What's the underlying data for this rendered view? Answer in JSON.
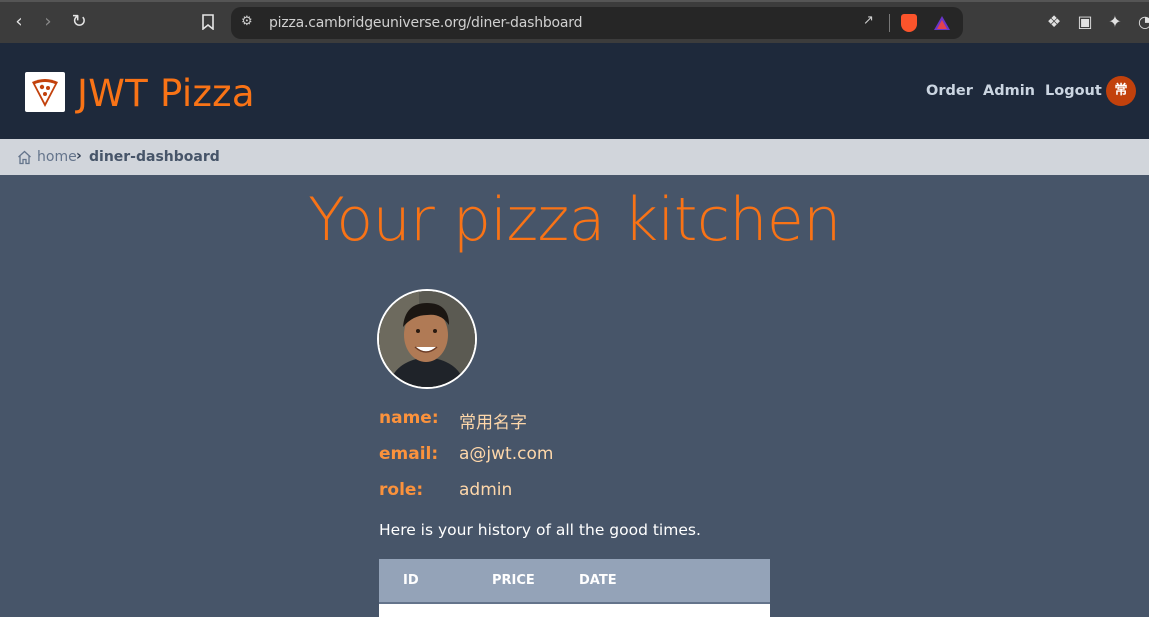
{
  "browser": {
    "url": "pizza.cambridgeuniverse.org/diner-dashboard"
  },
  "header": {
    "app_title": "JWT Pizza",
    "nav": [
      {
        "label": "Order"
      },
      {
        "label": "Admin"
      },
      {
        "label": "Logout"
      }
    ],
    "avatar_initial": "常"
  },
  "breadcrumb": {
    "home": "home",
    "current": "diner-dashboard"
  },
  "main": {
    "heading": "Your pizza kitchen",
    "profile": {
      "name_label": "name:",
      "name_value": "常用名字",
      "email_label": "email:",
      "email_value": "a@jwt.com",
      "role_label": "role:",
      "role_value": "admin"
    },
    "history_text": "Here is your history of all the good times.",
    "table": {
      "columns": [
        "ID",
        "PRICE",
        "DATE"
      ]
    }
  },
  "colors": {
    "accent": "#f97316",
    "header_bg": "#1e293b",
    "page_bg": "#475569",
    "breadcrumb_bg": "#d1d5db",
    "table_head_bg": "#94a3b8"
  }
}
